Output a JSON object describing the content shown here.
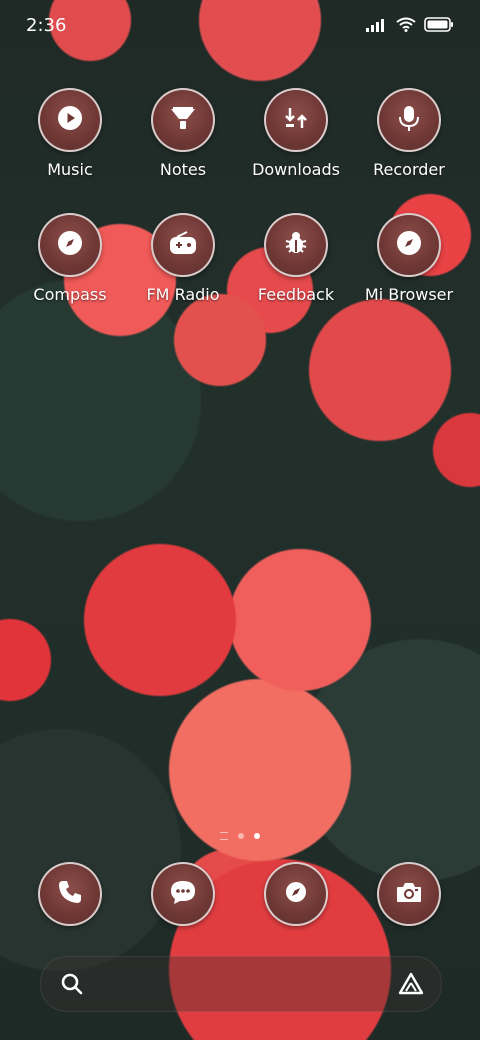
{
  "status_bar": {
    "time": "2:36",
    "icons": [
      "signal-icon",
      "wifi-icon",
      "battery-icon"
    ]
  },
  "apps_row1": [
    {
      "label": "Music",
      "icon": "play-icon"
    },
    {
      "label": "Notes",
      "icon": "notes-icon"
    },
    {
      "label": "Downloads",
      "icon": "downloads-icon"
    },
    {
      "label": "Recorder",
      "icon": "microphone-icon"
    }
  ],
  "apps_row2": [
    {
      "label": "Compass",
      "icon": "compass-icon"
    },
    {
      "label": "FM Radio",
      "icon": "radio-icon"
    },
    {
      "label": "Feedback",
      "icon": "bug-icon"
    },
    {
      "label": "Mi Browser",
      "icon": "browser-compass-icon"
    }
  ],
  "dock": [
    {
      "icon": "phone-icon"
    },
    {
      "icon": "messages-icon"
    },
    {
      "icon": "browser-icon"
    },
    {
      "icon": "camera-icon"
    }
  ],
  "page_indicator": {
    "pages": 2,
    "active_page": 2
  },
  "search_bar": {
    "left_icon": "search-icon",
    "right_icon": "assistant-icon"
  },
  "colors": {
    "icon_background": "#6e3734",
    "icon_border": "#ffffff",
    "text": "#ffffff"
  }
}
